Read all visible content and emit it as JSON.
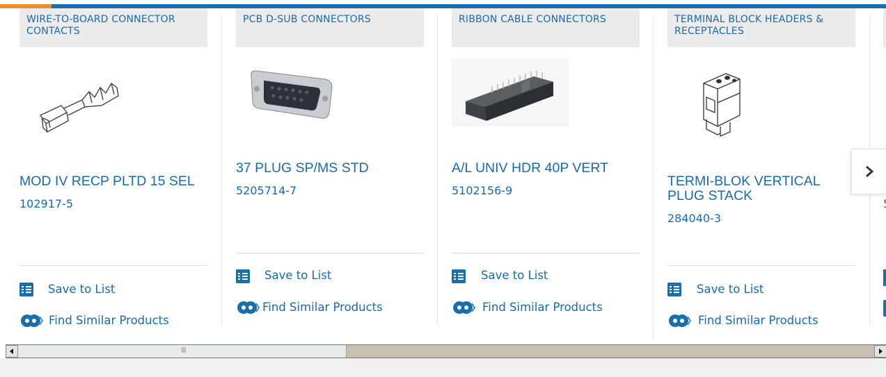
{
  "colors": {
    "brand_blue": "#1a6aa6",
    "accent_orange": "#e8912c",
    "category_bg": "#ebebeb"
  },
  "cards": [
    {
      "category": "WIRE-TO-BOARD CONNECTOR CONTACTS",
      "title": "MOD IV RECP PLTD 15 SEL",
      "part_number": "102917-5",
      "save_label": "Save to List",
      "similar_label": "Find Similar Products",
      "image_icon": "crimp-contact-image"
    },
    {
      "category": "PCB D-SUB CONNECTORS",
      "title": "37 PLUG SP/MS STD",
      "part_number": "5205714-7",
      "save_label": "Save to List",
      "similar_label": "Find Similar Products",
      "image_icon": "dsub-connector-image"
    },
    {
      "category": "RIBBON CABLE CONNECTORS",
      "title": "A/L UNIV HDR 40P VERT",
      "part_number": "5102156-9",
      "save_label": "Save to List",
      "similar_label": "Find Similar Products",
      "image_icon": "ribbon-header-image"
    },
    {
      "category": "TERMINAL BLOCK HEADERS & RECEPTACLES",
      "title": "TERMI-BLOK VERTICAL PLUG STACK",
      "part_number": "284040-3",
      "save_label": "Save to List",
      "similar_label": "Find Similar Products",
      "image_icon": "terminal-block-image"
    }
  ],
  "carousel": {
    "next_icon": "chevron-right-icon",
    "partial_part_number": "5"
  },
  "scrollbar": {
    "thumb_grip": "III"
  }
}
